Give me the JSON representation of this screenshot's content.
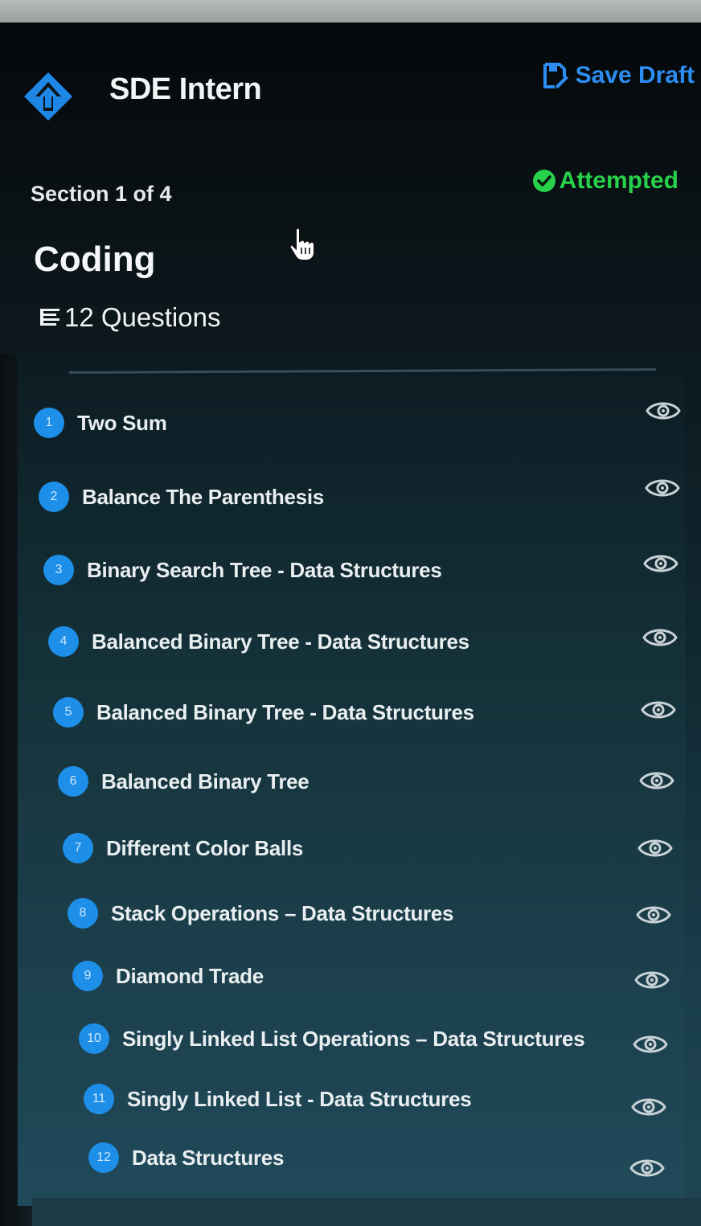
{
  "header": {
    "app_title": "SDE Intern",
    "save_label": "Save Draft"
  },
  "section": {
    "label": "Section 1 of 4",
    "status": "Attempted",
    "title": "Coding",
    "question_count": "12 Questions"
  },
  "colors": {
    "accent_blue": "#1e8fe8",
    "status_green": "#27d14a",
    "text_light": "#e9eef0"
  },
  "icons": {
    "logo": "diamond-arrow-logo",
    "save": "save-draft-icon",
    "status": "check-circle-icon",
    "list": "list-icon",
    "view": "eye-icon",
    "cursor": "hand-pointer-cursor"
  },
  "questions": [
    {
      "number": "1",
      "title": "Two Sum"
    },
    {
      "number": "2",
      "title": "Balance The Parenthesis"
    },
    {
      "number": "3",
      "title": "Binary Search Tree - Data Structures"
    },
    {
      "number": "4",
      "title": "Balanced Binary Tree - Data Structures"
    },
    {
      "number": "5",
      "title": "Balanced Binary Tree - Data Structures"
    },
    {
      "number": "6",
      "title": "Balanced Binary Tree"
    },
    {
      "number": "7",
      "title": "Different Color Balls"
    },
    {
      "number": "8",
      "title": "Stack Operations – Data Structures"
    },
    {
      "number": "9",
      "title": "Diamond Trade"
    },
    {
      "number": "10",
      "title": "Singly Linked List Operations – Data Structures"
    },
    {
      "number": "11",
      "title": "Singly Linked List - Data Structures"
    },
    {
      "number": "12",
      "title": "Data Structures"
    }
  ]
}
